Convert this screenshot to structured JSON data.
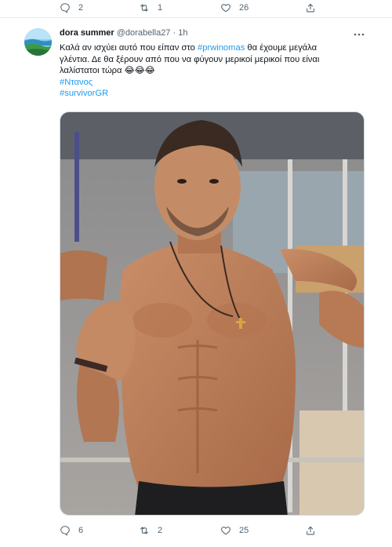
{
  "prev_tweet_actions": {
    "replies": "2",
    "retweets": "1",
    "likes": "26"
  },
  "tweet": {
    "author_name": "dora summer",
    "handle": "@dorabella27",
    "separator": "·",
    "time": "1h",
    "text_line1_before": "Καλά αν ισχύει αυτό που είπαν στο ",
    "text_line1_link": "#prwinomas",
    "text_line1_after": " θα έχουμε μεγάλα",
    "text_line2": "γλέντια. Δε θα ξέρουν από που να φύγουν μερικοί μερικοί που είναι",
    "text_line3": "λαλίστατοι τώρα 😂😂😂",
    "hashtag1": "#Ντανος",
    "hashtag2": "#survivorGR",
    "actions": {
      "replies": "6",
      "retweets": "2",
      "likes": "25"
    }
  },
  "colors": {
    "link": "#1d9bf0",
    "muted": "#536471",
    "text": "#0f1419"
  }
}
